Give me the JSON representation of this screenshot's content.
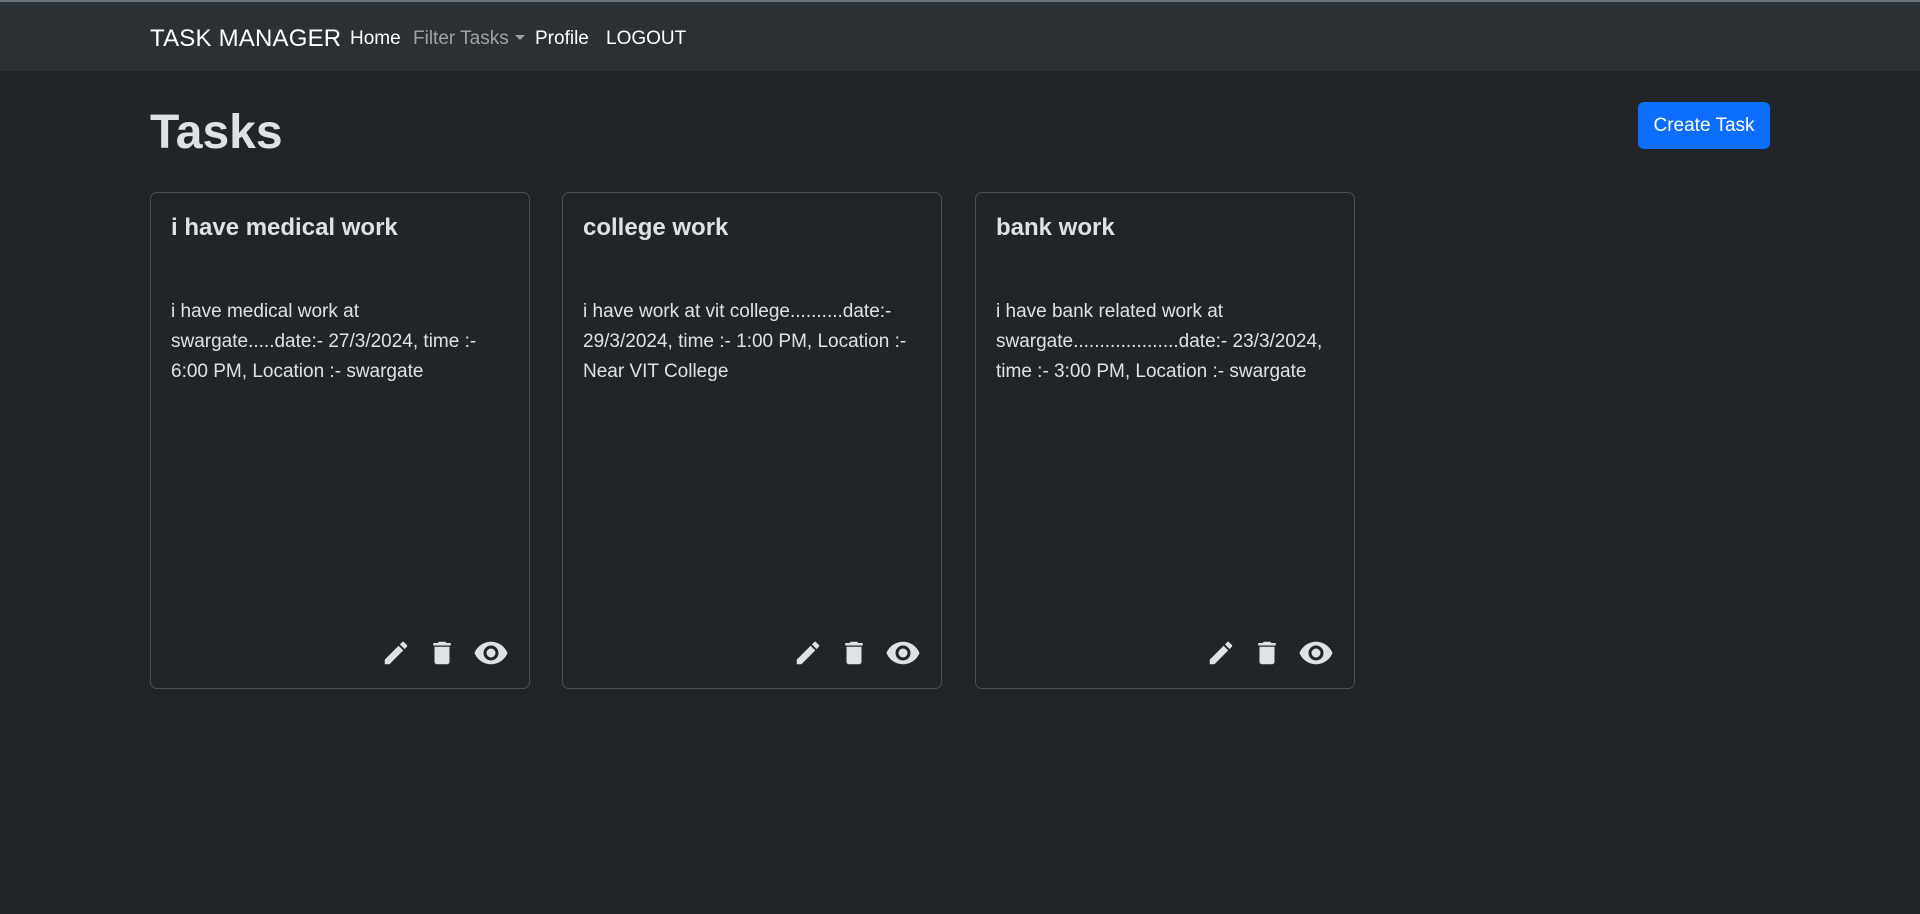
{
  "navbar": {
    "brand": "TASK MANAGER",
    "links": {
      "home": "Home",
      "filter": "Filter Tasks",
      "profile": "Profile",
      "logout": "LOGOUT"
    }
  },
  "page": {
    "title": "Tasks",
    "create_button": "Create Task"
  },
  "tasks": [
    {
      "title": "i have medical work",
      "description": "i have medical work at swargate.....date:- 27/3/2024, time :- 6:00 PM, Location :- swargate"
    },
    {
      "title": "college work",
      "description": "i have work at vit college..........date:- 29/3/2024, time :- 1:00 PM, Location :- Near VIT College"
    },
    {
      "title": "bank work",
      "description": "i have bank related work at swargate....................date:- 23/3/2024, time :- 3:00 PM, Location :- swargate"
    }
  ],
  "icons": {
    "edit": "pencil-icon",
    "delete": "trash-icon",
    "view": "eye-icon"
  },
  "colors": {
    "background": "#212529",
    "navbar": "#2b3035",
    "primary_button": "#0d6efd",
    "card_border": "#495057",
    "text": "#dee2e6"
  }
}
